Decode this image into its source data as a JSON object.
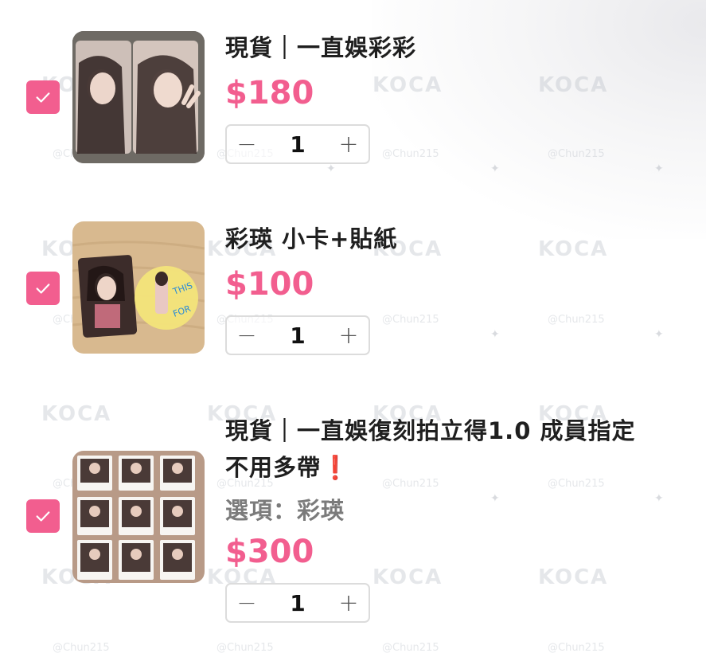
{
  "watermarks": {
    "logo": "KOCA",
    "handle": "@Chun215"
  },
  "items": [
    {
      "title": "現貨｜一直娛彩彩",
      "price": "$180",
      "quantity": "1",
      "checked": true,
      "thumbnail": "photo of two photocards of a woman making peace sign"
    },
    {
      "title": "彩瑛 小卡+貼紙",
      "price": "$100",
      "quantity": "1",
      "checked": true,
      "thumbnail": "photocard and round yellow sticker on wood"
    },
    {
      "title_line1": "現貨｜一直娛復刻拍立得1.0 成員指定",
      "title_line2": "不用多帶",
      "title_mark": "❗",
      "option": "選項：彩瑛",
      "price": "$300",
      "quantity": "1",
      "checked": true,
      "thumbnail": "grid of nine signed instant photos"
    }
  ],
  "controls": {
    "minus": "−",
    "plus": "+"
  },
  "colors": {
    "accent": "#f25e8f",
    "title": "#1f1f1f",
    "option": "#7b7b7b"
  }
}
